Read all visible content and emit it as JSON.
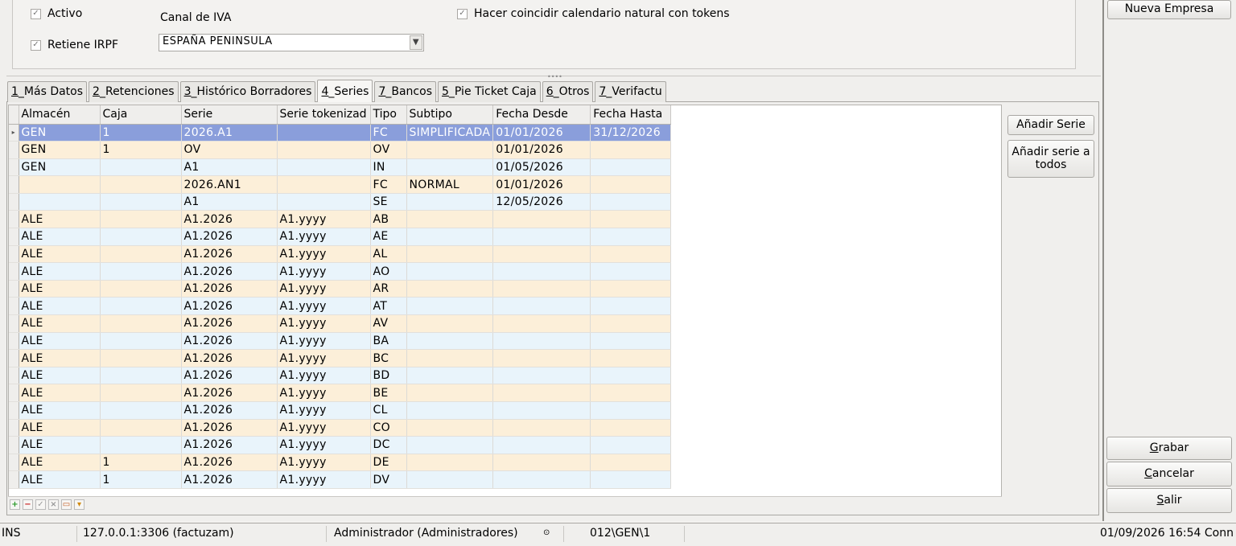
{
  "top": {
    "activo_label": "Activo",
    "retiene_label": "Retiene IRPF",
    "canal_label": "Canal de IVA",
    "canal_value": "ESPAÑA PENINSULA",
    "calendario_label": "Hacer coincidir calendario natural con tokens"
  },
  "tabs": [
    {
      "key": "1",
      "rest": "_Más Datos"
    },
    {
      "key": "2",
      "rest": "_Retenciones"
    },
    {
      "key": "3",
      "rest": "_Histórico Borradores"
    },
    {
      "key": "4",
      "rest": "_Series"
    },
    {
      "key": "7",
      "rest": "_Bancos"
    },
    {
      "key": "5",
      "rest": "_Pie Ticket Caja"
    },
    {
      "key": "6",
      "rest": "_Otros"
    },
    {
      "key": "7",
      "rest": "_Verifactu"
    }
  ],
  "grid": {
    "headers": [
      "Almacén",
      "Caja",
      "Serie",
      "Serie tokenizad",
      "Tipo",
      "Subtipo",
      "Fecha Desde",
      "Fecha Hasta"
    ],
    "rows": [
      [
        "GEN",
        "1",
        "2026.A1",
        "",
        "FC",
        "SIMPLIFICADA",
        "01/01/2026",
        "31/12/2026"
      ],
      [
        "GEN",
        "1",
        "OV",
        "",
        "OV",
        "",
        "01/01/2026",
        ""
      ],
      [
        "GEN",
        "",
        "A1",
        "",
        "IN",
        "",
        "01/05/2026",
        ""
      ],
      [
        "",
        "",
        "2026.AN1",
        "",
        "FC",
        "NORMAL",
        "01/01/2026",
        ""
      ],
      [
        "",
        "",
        "A1",
        "",
        "SE",
        "",
        "12/05/2026",
        ""
      ],
      [
        "ALE",
        "",
        "A1.2026",
        "A1.yyyy",
        "AB",
        "",
        "",
        ""
      ],
      [
        "ALE",
        "",
        "A1.2026",
        "A1.yyyy",
        "AE",
        "",
        "",
        ""
      ],
      [
        "ALE",
        "",
        "A1.2026",
        "A1.yyyy",
        "AL",
        "",
        "",
        ""
      ],
      [
        "ALE",
        "",
        "A1.2026",
        "A1.yyyy",
        "AO",
        "",
        "",
        ""
      ],
      [
        "ALE",
        "",
        "A1.2026",
        "A1.yyyy",
        "AR",
        "",
        "",
        ""
      ],
      [
        "ALE",
        "",
        "A1.2026",
        "A1.yyyy",
        "AT",
        "",
        "",
        ""
      ],
      [
        "ALE",
        "",
        "A1.2026",
        "A1.yyyy",
        "AV",
        "",
        "",
        ""
      ],
      [
        "ALE",
        "",
        "A1.2026",
        "A1.yyyy",
        "BA",
        "",
        "",
        ""
      ],
      [
        "ALE",
        "",
        "A1.2026",
        "A1.yyyy",
        "BC",
        "",
        "",
        ""
      ],
      [
        "ALE",
        "",
        "A1.2026",
        "A1.yyyy",
        "BD",
        "",
        "",
        ""
      ],
      [
        "ALE",
        "",
        "A1.2026",
        "A1.yyyy",
        "BE",
        "",
        "",
        ""
      ],
      [
        "ALE",
        "",
        "A1.2026",
        "A1.yyyy",
        "CL",
        "",
        "",
        ""
      ],
      [
        "ALE",
        "",
        "A1.2026",
        "A1.yyyy",
        "CO",
        "",
        "",
        ""
      ],
      [
        "ALE",
        "",
        "A1.2026",
        "A1.yyyy",
        "DC",
        "",
        "",
        ""
      ],
      [
        "ALE",
        "1",
        "A1.2026",
        "A1.yyyy",
        "DE",
        "",
        "",
        ""
      ],
      [
        "ALE",
        "1",
        "A1.2026",
        "A1.yyyy",
        "DV",
        "",
        "",
        ""
      ]
    ]
  },
  "buttons": {
    "add_serie": "Añadir Serie",
    "add_serie_all_1": "Añadir serie a",
    "add_serie_all_2": "todos",
    "nueva_empresa": "Nueva Empresa",
    "grabar_u": "G",
    "grabar_rest": "rabar",
    "cancelar_u": "C",
    "cancelar_rest": "ancelar",
    "salir_u": "S",
    "salir_rest": "alir"
  },
  "status": {
    "mode": "INS",
    "db": "127.0.0.1:3306 (factuzam)",
    "user": "Administrador (Administradores)",
    "path": "012\\GEN\\1",
    "datetime": "01/09/2026 16:54 Conn"
  }
}
